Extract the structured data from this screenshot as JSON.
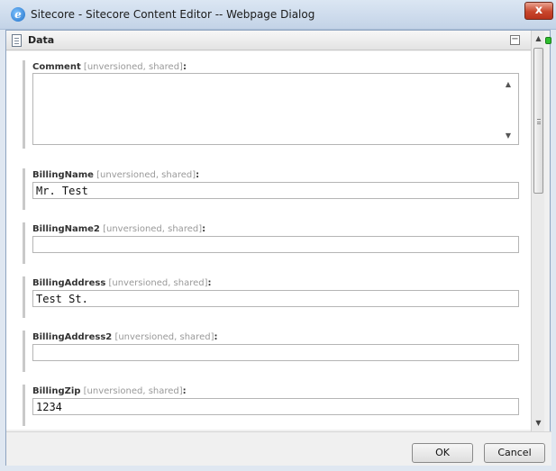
{
  "window": {
    "title": "Sitecore - Sitecore Content Editor -- Webpage Dialog",
    "close_label": "x"
  },
  "section": {
    "title": "Data",
    "collapse_label": "−"
  },
  "fields": [
    {
      "name": "Comment",
      "meta": "[unversioned, shared]",
      "colon": ":",
      "type": "textarea",
      "value": ""
    },
    {
      "name": "BillingName",
      "meta": "[unversioned, shared]",
      "colon": ":",
      "type": "text",
      "value": "Mr. Test"
    },
    {
      "name": "BillingName2",
      "meta": "[unversioned, shared]",
      "colon": ":",
      "type": "text",
      "value": ""
    },
    {
      "name": "BillingAddress",
      "meta": "[unversioned, shared]",
      "colon": ":",
      "type": "text",
      "value": "Test St."
    },
    {
      "name": "BillingAddress2",
      "meta": "[unversioned, shared]",
      "colon": ":",
      "type": "text",
      "value": ""
    },
    {
      "name": "BillingZip",
      "meta": "[unversioned, shared]",
      "colon": ":",
      "type": "text",
      "value": "1234"
    }
  ],
  "footer": {
    "ok_label": "OK",
    "cancel_label": "Cancel"
  },
  "scrollbar": {
    "up": "▲",
    "down": "▼"
  },
  "colors": {
    "status_indicator": "#2fbe2f",
    "close_button": "#c8462c"
  }
}
